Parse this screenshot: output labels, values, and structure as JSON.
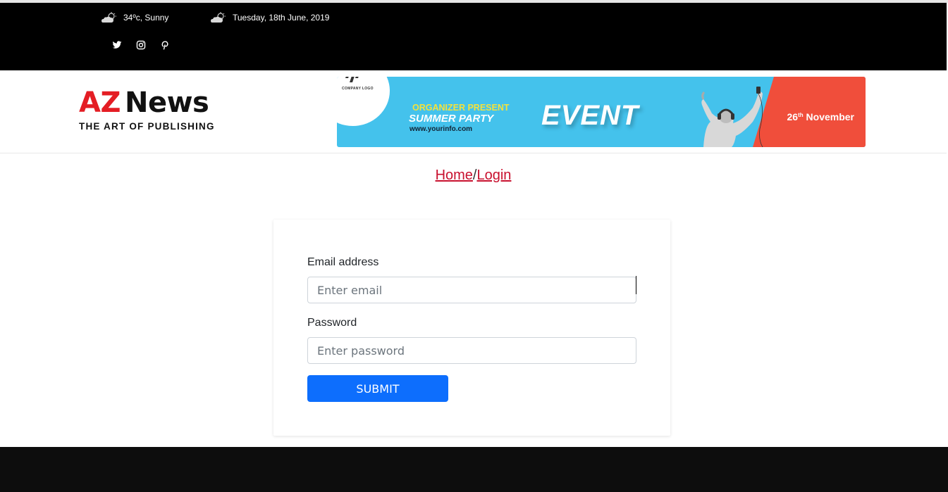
{
  "topbar": {
    "weather": "34ºc, Sunny",
    "date": "Tuesday, 18th June, 2019",
    "socials": [
      "twitter-icon",
      "instagram-icon",
      "pinterest-icon"
    ]
  },
  "logo": {
    "az": "AZ",
    "news": "News",
    "tagline": "THE ART OF PUBLISHING"
  },
  "banner": {
    "company": "COMPANY LOGO",
    "organizer": "ORGANIZER PRESENT",
    "party": "SUMMER PARTY",
    "url": "www.yourinfo.com",
    "event": "EVENT",
    "date_num": "26",
    "date_sup": "th",
    "date_month": "November"
  },
  "breadcrumb": {
    "home": "Home",
    "separator": "/",
    "current": "Login"
  },
  "form": {
    "email_label": "Email address",
    "email_placeholder": "Enter email",
    "password_label": "Password",
    "password_placeholder": "Enter password",
    "submit_label": "SUBMIT"
  },
  "colors": {
    "accent_red": "#e41d24",
    "link_red": "#c8102e",
    "primary_button": "#0d6efd",
    "banner_blue": "#44c2ec",
    "banner_red": "#f04e3b"
  }
}
